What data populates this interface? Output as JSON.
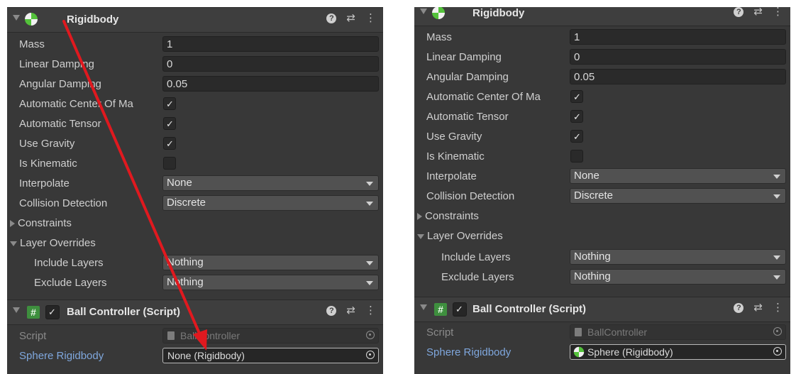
{
  "colors": {
    "accent_arrow": "#e0191f",
    "panel_bg": "#383838",
    "label_blue": "#7fa7dd"
  },
  "panels": [
    {
      "rigidbody_header": {
        "title": "Rigidbody"
      },
      "mass": {
        "label": "Mass",
        "value": "1"
      },
      "linear_damping": {
        "label": "Linear Damping",
        "value": "0"
      },
      "angular_damping": {
        "label": "Angular Damping",
        "value": "0.05"
      },
      "auto_center": {
        "label": "Automatic Center Of Ma",
        "checked": true
      },
      "auto_tensor": {
        "label": "Automatic Tensor",
        "checked": true
      },
      "use_gravity": {
        "label": "Use Gravity",
        "checked": true
      },
      "is_kinematic": {
        "label": "Is Kinematic",
        "checked": false
      },
      "interpolate": {
        "label": "Interpolate",
        "value": "None"
      },
      "collision": {
        "label": "Collision Detection",
        "value": "Discrete"
      },
      "constraints": {
        "label": "Constraints"
      },
      "layer_overrides": {
        "label": "Layer Overrides"
      },
      "include_layers": {
        "label": "Include Layers",
        "value": "Nothing"
      },
      "exclude_layers": {
        "label": "Exclude Layers",
        "value": "Nothing"
      },
      "script_header": {
        "title": "Ball Controller (Script)",
        "enabled": true
      },
      "script_field": {
        "label": "Script",
        "value": "BallController"
      },
      "sphere_rb": {
        "label": "Sphere Rigidbody",
        "value": "None (Rigidbody)"
      }
    },
    {
      "rigidbody_header": {
        "title": "Rigidbody"
      },
      "mass": {
        "label": "Mass",
        "value": "1"
      },
      "linear_damping": {
        "label": "Linear Damping",
        "value": "0"
      },
      "angular_damping": {
        "label": "Angular Damping",
        "value": "0.05"
      },
      "auto_center": {
        "label": "Automatic Center Of Ma",
        "checked": true
      },
      "auto_tensor": {
        "label": "Automatic Tensor",
        "checked": true
      },
      "use_gravity": {
        "label": "Use Gravity",
        "checked": true
      },
      "is_kinematic": {
        "label": "Is Kinematic",
        "checked": false
      },
      "interpolate": {
        "label": "Interpolate",
        "value": "None"
      },
      "collision": {
        "label": "Collision Detection",
        "value": "Discrete"
      },
      "constraints": {
        "label": "Constraints"
      },
      "layer_overrides": {
        "label": "Layer Overrides"
      },
      "include_layers": {
        "label": "Include Layers",
        "value": "Nothing"
      },
      "exclude_layers": {
        "label": "Exclude Layers",
        "value": "Nothing"
      },
      "script_header": {
        "title": "Ball Controller (Script)",
        "enabled": true
      },
      "script_field": {
        "label": "Script",
        "value": "BallController"
      },
      "sphere_rb": {
        "label": "Sphere Rigidbody",
        "value": "Sphere (Rigidbody)"
      }
    }
  ]
}
